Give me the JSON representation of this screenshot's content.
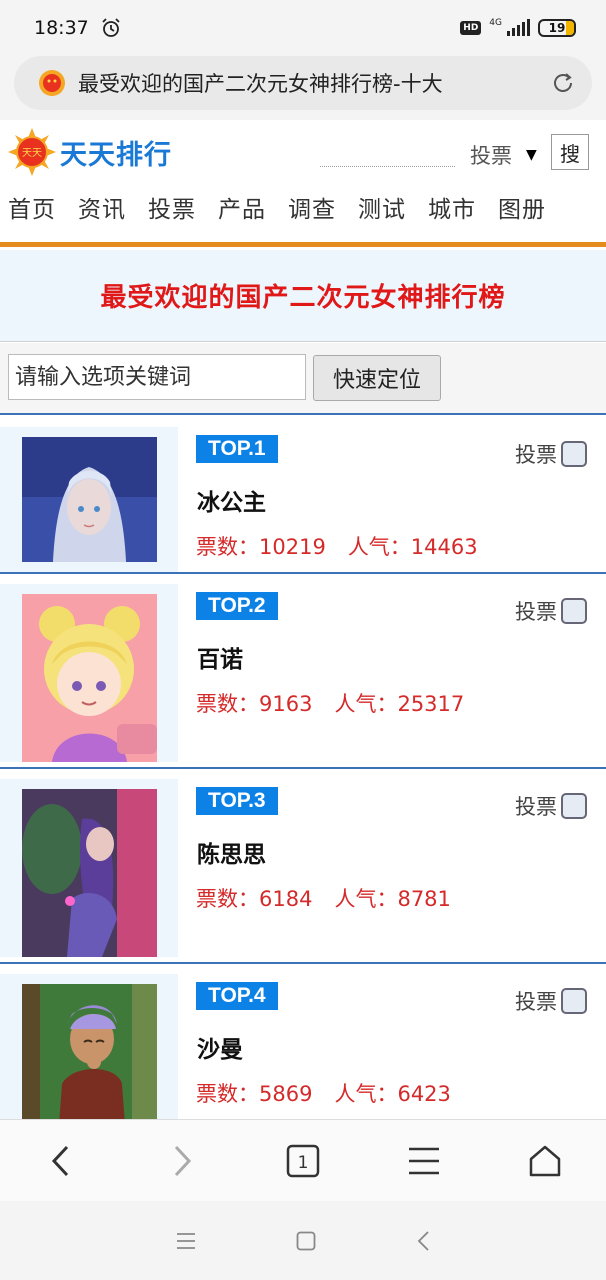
{
  "status": {
    "time": "18:37",
    "hd": "HD",
    "network": "4G",
    "battery": "19"
  },
  "address": {
    "title": "最受欢迎的国产二次元女神排行榜-十大"
  },
  "header": {
    "logo_text": "天天排行",
    "vote_option": "投票",
    "search_label": "搜"
  },
  "nav": [
    "首页",
    "资讯",
    "投票",
    "产品",
    "调查",
    "测试",
    "城市",
    "图册"
  ],
  "banner": {
    "title": "最受欢迎的国产二次元女神排行榜"
  },
  "search": {
    "placeholder": "请输入选项关键词",
    "button": "快速定位"
  },
  "items": [
    {
      "rank": "TOP.1",
      "name": "冰公主",
      "votes": "票数：10219",
      "popularity": "人气：14463",
      "vote_label": "投票"
    },
    {
      "rank": "TOP.2",
      "name": "百诺",
      "votes": "票数：9163",
      "popularity": "人气：25317",
      "vote_label": "投票"
    },
    {
      "rank": "TOP.3",
      "name": "陈思思",
      "votes": "票数：6184",
      "popularity": "人气：8781",
      "vote_label": "投票"
    },
    {
      "rank": "TOP.4",
      "name": "沙曼",
      "votes": "票数：5869",
      "popularity": "人气：6423",
      "vote_label": "投票"
    }
  ],
  "toolbar": {
    "tab_count": "1"
  },
  "colors": {
    "accent_blue": "#0c81e6",
    "title_red": "#e01818",
    "nav_orange": "#e58a1c",
    "list_border": "#3c73b8"
  }
}
